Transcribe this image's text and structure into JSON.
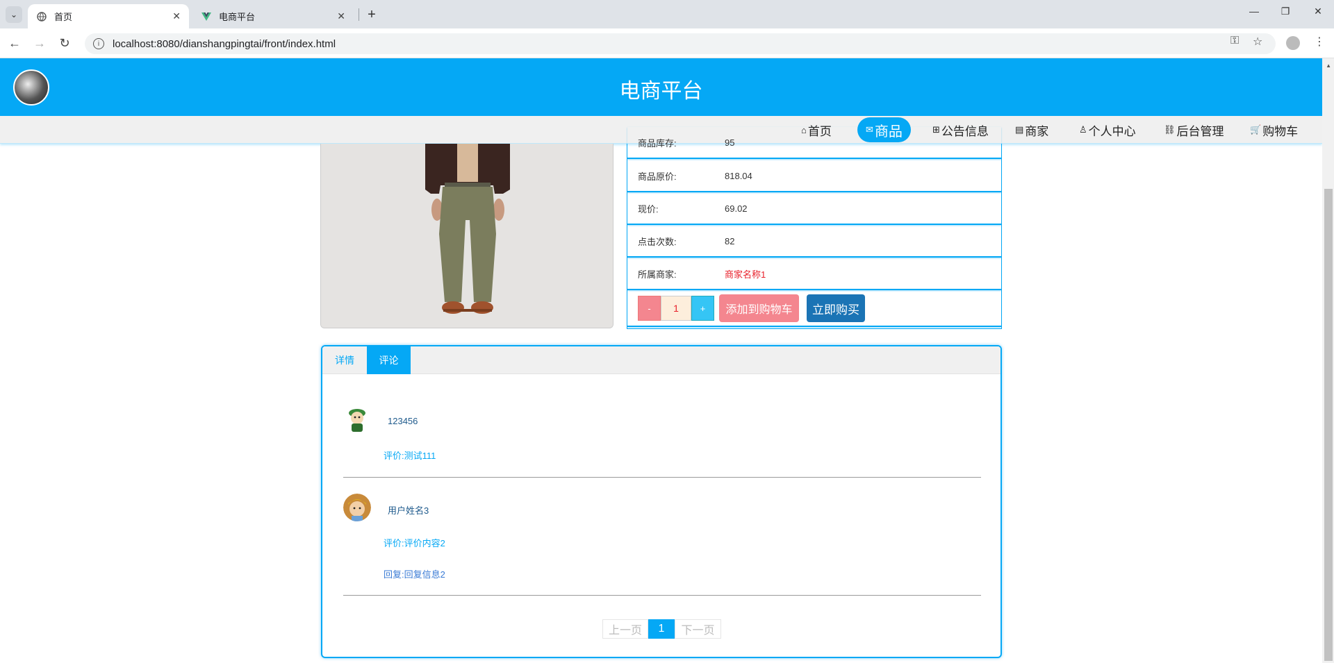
{
  "browser": {
    "tabs": [
      {
        "title": "首页",
        "active": true
      },
      {
        "title": "电商平台",
        "active": false
      }
    ],
    "url": "localhost:8080/dianshangpingtai/front/index.html"
  },
  "site": {
    "title": "电商平台"
  },
  "nav": {
    "items": [
      {
        "label": "首页",
        "icon": "home-icon"
      },
      {
        "label": "商品",
        "icon": "mail-icon",
        "active": true
      },
      {
        "label": "公告信息",
        "icon": "gift-icon"
      },
      {
        "label": "商家",
        "icon": "calendar-icon"
      },
      {
        "label": "个人中心",
        "icon": "user-icon"
      },
      {
        "label": "后台管理",
        "icon": "link-icon"
      },
      {
        "label": "购物车",
        "icon": "cart-icon"
      }
    ]
  },
  "product": {
    "rows": [
      {
        "label": "商品库存:",
        "value": "95"
      },
      {
        "label": "商品原价:",
        "value": "818.04"
      },
      {
        "label": "现价:",
        "value": "69.02"
      },
      {
        "label": "点击次数:",
        "value": "82"
      },
      {
        "label": "所属商家:",
        "value": "商家名称1"
      }
    ],
    "quantity": "1",
    "minus": "-",
    "plus": "+",
    "add_to_cart": "添加到购物车",
    "buy_now": "立即购买"
  },
  "panel": {
    "tabs": [
      {
        "label": "详情",
        "active": false
      },
      {
        "label": "评论",
        "active": true
      }
    ],
    "comments": [
      {
        "name": "123456",
        "text": "评价:测试111",
        "reply": ""
      },
      {
        "name": "用户姓名3",
        "text": "评价:评价内容2",
        "reply": "回复:回复信息2"
      }
    ],
    "pager": {
      "prev": "上一页",
      "current": "1",
      "next": "下一页"
    }
  },
  "colors": {
    "brand": "#05a8f5",
    "price_red": "#e8202a",
    "cart_btn": "#f4868f",
    "buy_btn": "#1b74b5"
  }
}
